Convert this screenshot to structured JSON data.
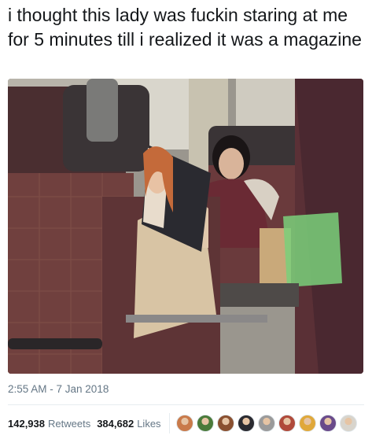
{
  "tweet": {
    "text": "i thought this lady was fuckin staring at me for 5 minutes till i realized it was a magazine",
    "timestamp": "2:55 AM - 7 Jan 2018"
  },
  "stats": {
    "retweets_count": "142,938",
    "retweets_label": "Retweets",
    "likes_count": "384,682",
    "likes_label": "Likes"
  },
  "avatars": [
    {
      "name": "liker-avatar",
      "color": "#c97a4a"
    },
    {
      "name": "liker-avatar",
      "color": "#4a7a3a"
    },
    {
      "name": "liker-avatar",
      "color": "#8a5030"
    },
    {
      "name": "liker-avatar",
      "color": "#2a2a30"
    },
    {
      "name": "liker-avatar",
      "color": "#9a9a9a"
    },
    {
      "name": "liker-avatar",
      "color": "#b04a3a"
    },
    {
      "name": "liker-avatar",
      "color": "#e0a83a"
    },
    {
      "name": "liker-avatar",
      "color": "#6a4a8a"
    },
    {
      "name": "liker-avatar",
      "color": "#d8d4cc"
    }
  ]
}
